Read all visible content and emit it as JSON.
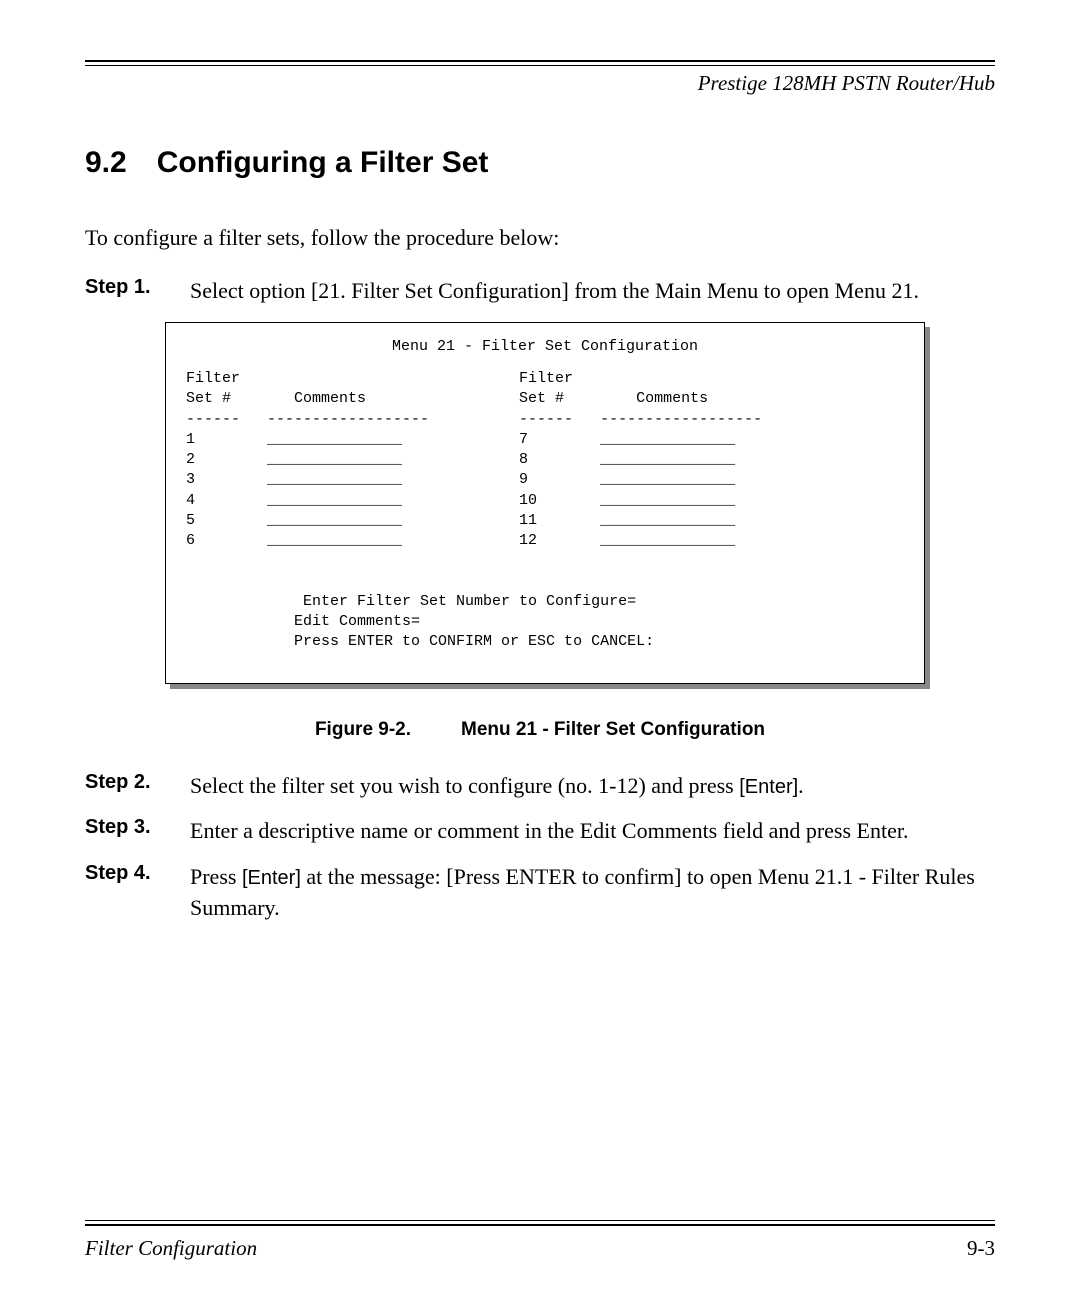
{
  "header": {
    "running_title": "Prestige 128MH  PSTN Router/Hub"
  },
  "section": {
    "number": "9.2",
    "title": "Configuring a Filter Set"
  },
  "intro": "To configure a filter sets, follow the procedure below:",
  "steps": [
    {
      "label": "Step 1.",
      "text": "Select option [21. Filter Set Configuration] from the Main Menu to open Menu 21."
    },
    {
      "label": "Step 2.",
      "text_prefix": "Select the filter set you wish to configure (no. 1-12) and press ",
      "key": "[Enter]",
      "text_suffix": "."
    },
    {
      "label": "Step 3.",
      "text": "Enter a descriptive name or comment in the Edit Comments field and press Enter."
    },
    {
      "label": "Step 4.",
      "text_prefix": "Press ",
      "key": "[Enter]",
      "text_suffix": " at the message: [Press ENTER to confirm] to open Menu 21.1 - Filter Rules Summary."
    }
  ],
  "terminal": {
    "title": "Menu 21 - Filter Set Configuration",
    "col_headers": {
      "set_left": "Filter\nSet #",
      "comments_left": "Comments",
      "set_right": "Filter\nSet #",
      "comments_right": "Comments"
    },
    "rows_left": [
      "1",
      "2",
      "3",
      "4",
      "5",
      "6"
    ],
    "rows_right": [
      "7",
      "8",
      "9",
      "10",
      "11",
      "12"
    ],
    "prompt1": "Enter Filter Set Number to Configure=",
    "prompt2": "Edit Comments=",
    "prompt3": "Press ENTER to CONFIRM or ESC to CANCEL:"
  },
  "figure": {
    "number": "Figure 9-2.",
    "caption": "Menu 21 - Filter Set Configuration"
  },
  "footer": {
    "section_name": "Filter Configuration",
    "page_number": "9-3"
  }
}
